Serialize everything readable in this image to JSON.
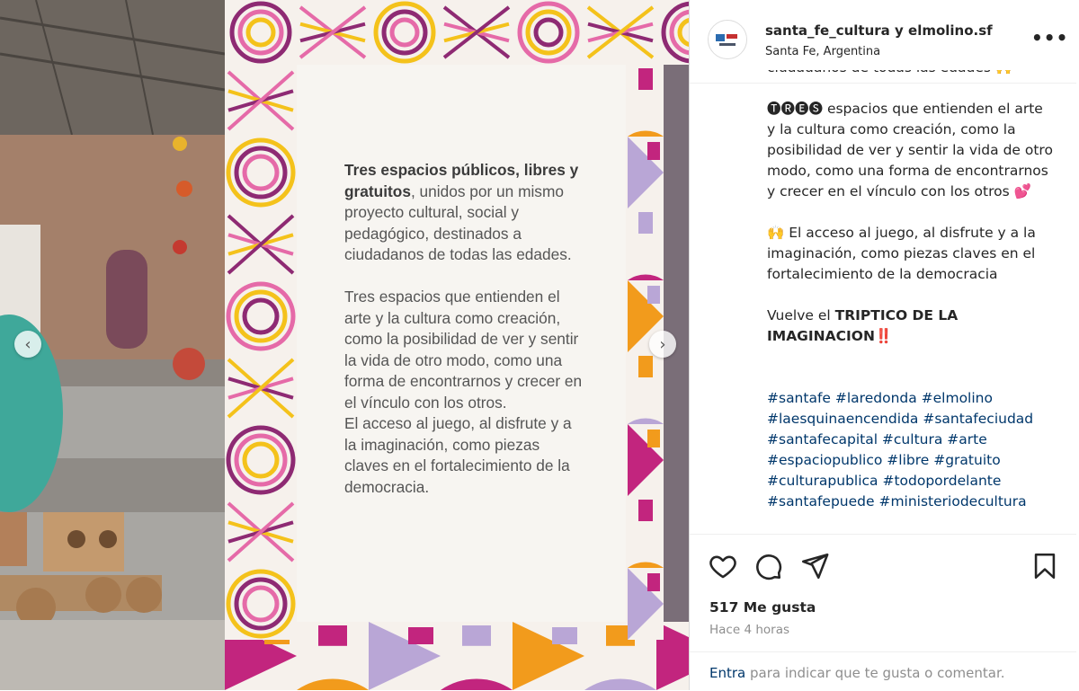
{
  "post": {
    "username": "santa_fe_cultura y elmolino.sf",
    "location": "Santa Fe, Argentina",
    "more_icon": "more-horizontal-icon"
  },
  "media": {
    "prev_icon": "chevron-left-icon",
    "next_icon": "chevron-right-icon",
    "prev_glyph": "‹",
    "next_glyph": "›",
    "card_p1_bold": "Tres espacios públicos, libres y gratuitos",
    "card_p1_rest": ", unidos por un mismo proyecto cultural, social y pedagógico, destinados a ciudadanos de todas las edades.",
    "card_p2a": "Tres espacios que entienden el arte y la cultura como creación, como la posibilidad de ver y sentir la vida de otro modo, como una forma de encontrarnos y crecer en el vínculo con los otros.",
    "card_p2b": "El acceso al juego, al disfrute y a la imaginación, como piezas claves en el fortalecimiento de la democracia."
  },
  "caption": {
    "top_partial": "ciudadanos de todas las edades 🙌",
    "tres_emoji": "🅣🅡🅔🅢",
    "tres_text": " espacios que entienden el arte y la cultura como creación, como la posibilidad de ver y sentir la vida de otro modo, como una forma de encontrarnos y crecer en el vínculo con los otros 💕",
    "acceso": "🙌 El acceso al juego, al disfrute y a la imaginación, como piezas claves en el fortalecimiento de la democracia",
    "vuelve_pre": "Vuelve el ",
    "vuelve_bold": "TRIPTICO DE LA IMAGINACION",
    "vuelve_post": "‼️",
    "hashtags": "#santafe #laredonda #elmolino #laesquinaencendida #santafeciudad #santafecapital #cultura #arte #espaciopublico #libre #gratuito #culturapublica #todopordelante #santafepuede #ministeriodecultura"
  },
  "actions": {
    "like_icon": "heart-icon",
    "comment_icon": "comment-icon",
    "share_icon": "send-icon",
    "save_icon": "bookmark-icon"
  },
  "stats": {
    "likes": "517 Me gusta",
    "time": "Hace 4 horas"
  },
  "footer": {
    "link": "Entra",
    "rest": "para indicar que te gusta o comentar."
  },
  "colors": {
    "purple": "#8e2a73",
    "magenta": "#c2257e",
    "pink": "#e56aa8",
    "orange": "#f29b1c",
    "yellow": "#f4c21b",
    "lilac": "#b9a6d6",
    "link": "#00376b"
  }
}
